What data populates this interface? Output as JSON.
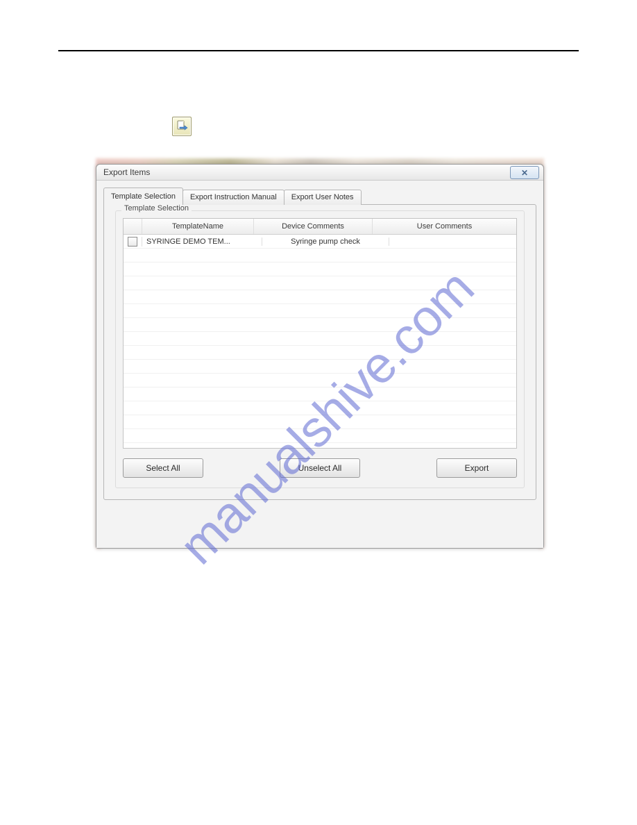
{
  "watermark": "manualshive.com",
  "dialog": {
    "title": "Export Items",
    "tabs": [
      {
        "label": "Template Selection",
        "active": true
      },
      {
        "label": "Export Instruction Manual",
        "active": false
      },
      {
        "label": "Export User Notes",
        "active": false
      }
    ],
    "group_label": "Template Selection",
    "columns": {
      "template_name": "TemplateName",
      "device_comments": "Device Comments",
      "user_comments": "User Comments"
    },
    "rows": [
      {
        "checked": false,
        "template_name": "SYRINGE DEMO TEM...",
        "device_comments": "Syringe pump check",
        "user_comments": ""
      }
    ],
    "buttons": {
      "select_all": "Select All",
      "unselect_all": "Unselect All",
      "export": "Export"
    }
  }
}
